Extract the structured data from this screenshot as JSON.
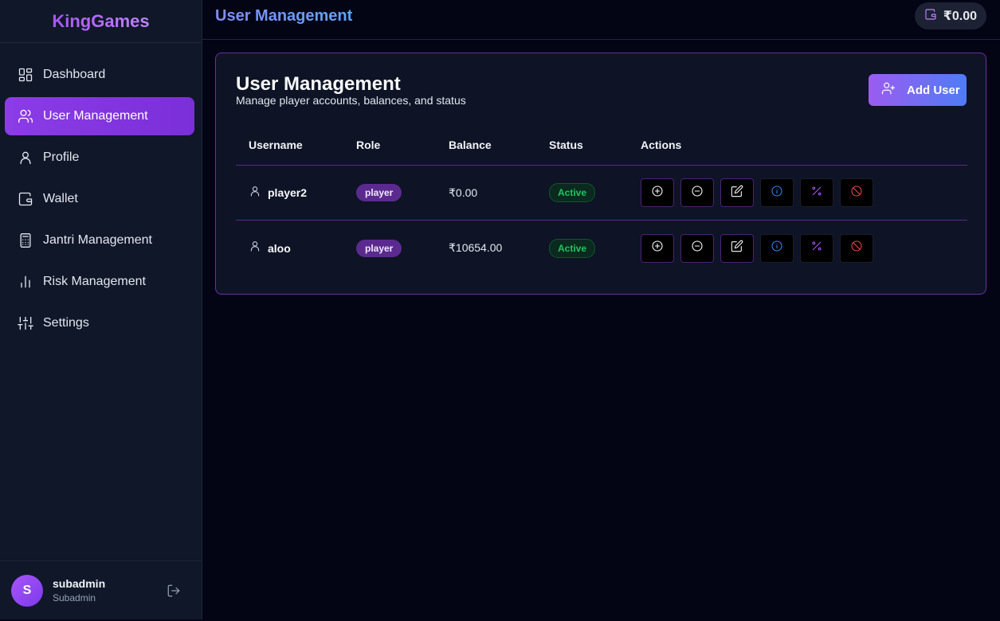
{
  "app": {
    "brand": "KingGames"
  },
  "header": {
    "title": "User Management",
    "wallet_balance": "₹0.00"
  },
  "sidebar": {
    "items": [
      {
        "label": "Dashboard",
        "icon": "dashboard-icon",
        "active": false
      },
      {
        "label": "User Management",
        "icon": "users-icon",
        "active": true
      },
      {
        "label": "Profile",
        "icon": "user-icon",
        "active": false
      },
      {
        "label": "Wallet",
        "icon": "wallet-icon",
        "active": false
      },
      {
        "label": "Jantri Management",
        "icon": "calculator-icon",
        "active": false
      },
      {
        "label": "Risk Management",
        "icon": "bar-chart-icon",
        "active": false
      },
      {
        "label": "Settings",
        "icon": "sliders-icon",
        "active": false
      }
    ],
    "user": {
      "initial": "S",
      "name": "subadmin",
      "role": "Subadmin"
    }
  },
  "main": {
    "title": "User Management",
    "subtitle": "Manage player accounts, balances, and status",
    "add_button": "Add User",
    "table": {
      "columns": [
        "Username",
        "Role",
        "Balance",
        "Status",
        "Actions"
      ],
      "rows": [
        {
          "username": "player2",
          "role": "player",
          "balance": "₹0.00",
          "status": "Active"
        },
        {
          "username": "aloo",
          "role": "player",
          "balance": "₹10654.00",
          "status": "Active"
        }
      ],
      "actions": [
        {
          "name": "add-balance-button",
          "icon": "plus-circle-icon",
          "color": "#ffffff"
        },
        {
          "name": "deduct-balance-button",
          "icon": "minus-circle-icon",
          "color": "#ffffff"
        },
        {
          "name": "edit-user-button",
          "icon": "edit-icon",
          "color": "#ffffff"
        },
        {
          "name": "user-info-button",
          "icon": "info-icon",
          "color": "#3b82f6"
        },
        {
          "name": "commission-button",
          "icon": "percent-icon",
          "color": "#a855f7"
        },
        {
          "name": "block-user-button",
          "icon": "ban-icon",
          "color": "#ef4444"
        }
      ]
    }
  },
  "colors": {
    "accent": "#8b3ce6",
    "active_status": "#22c55e",
    "border": "#6b2fa6"
  }
}
